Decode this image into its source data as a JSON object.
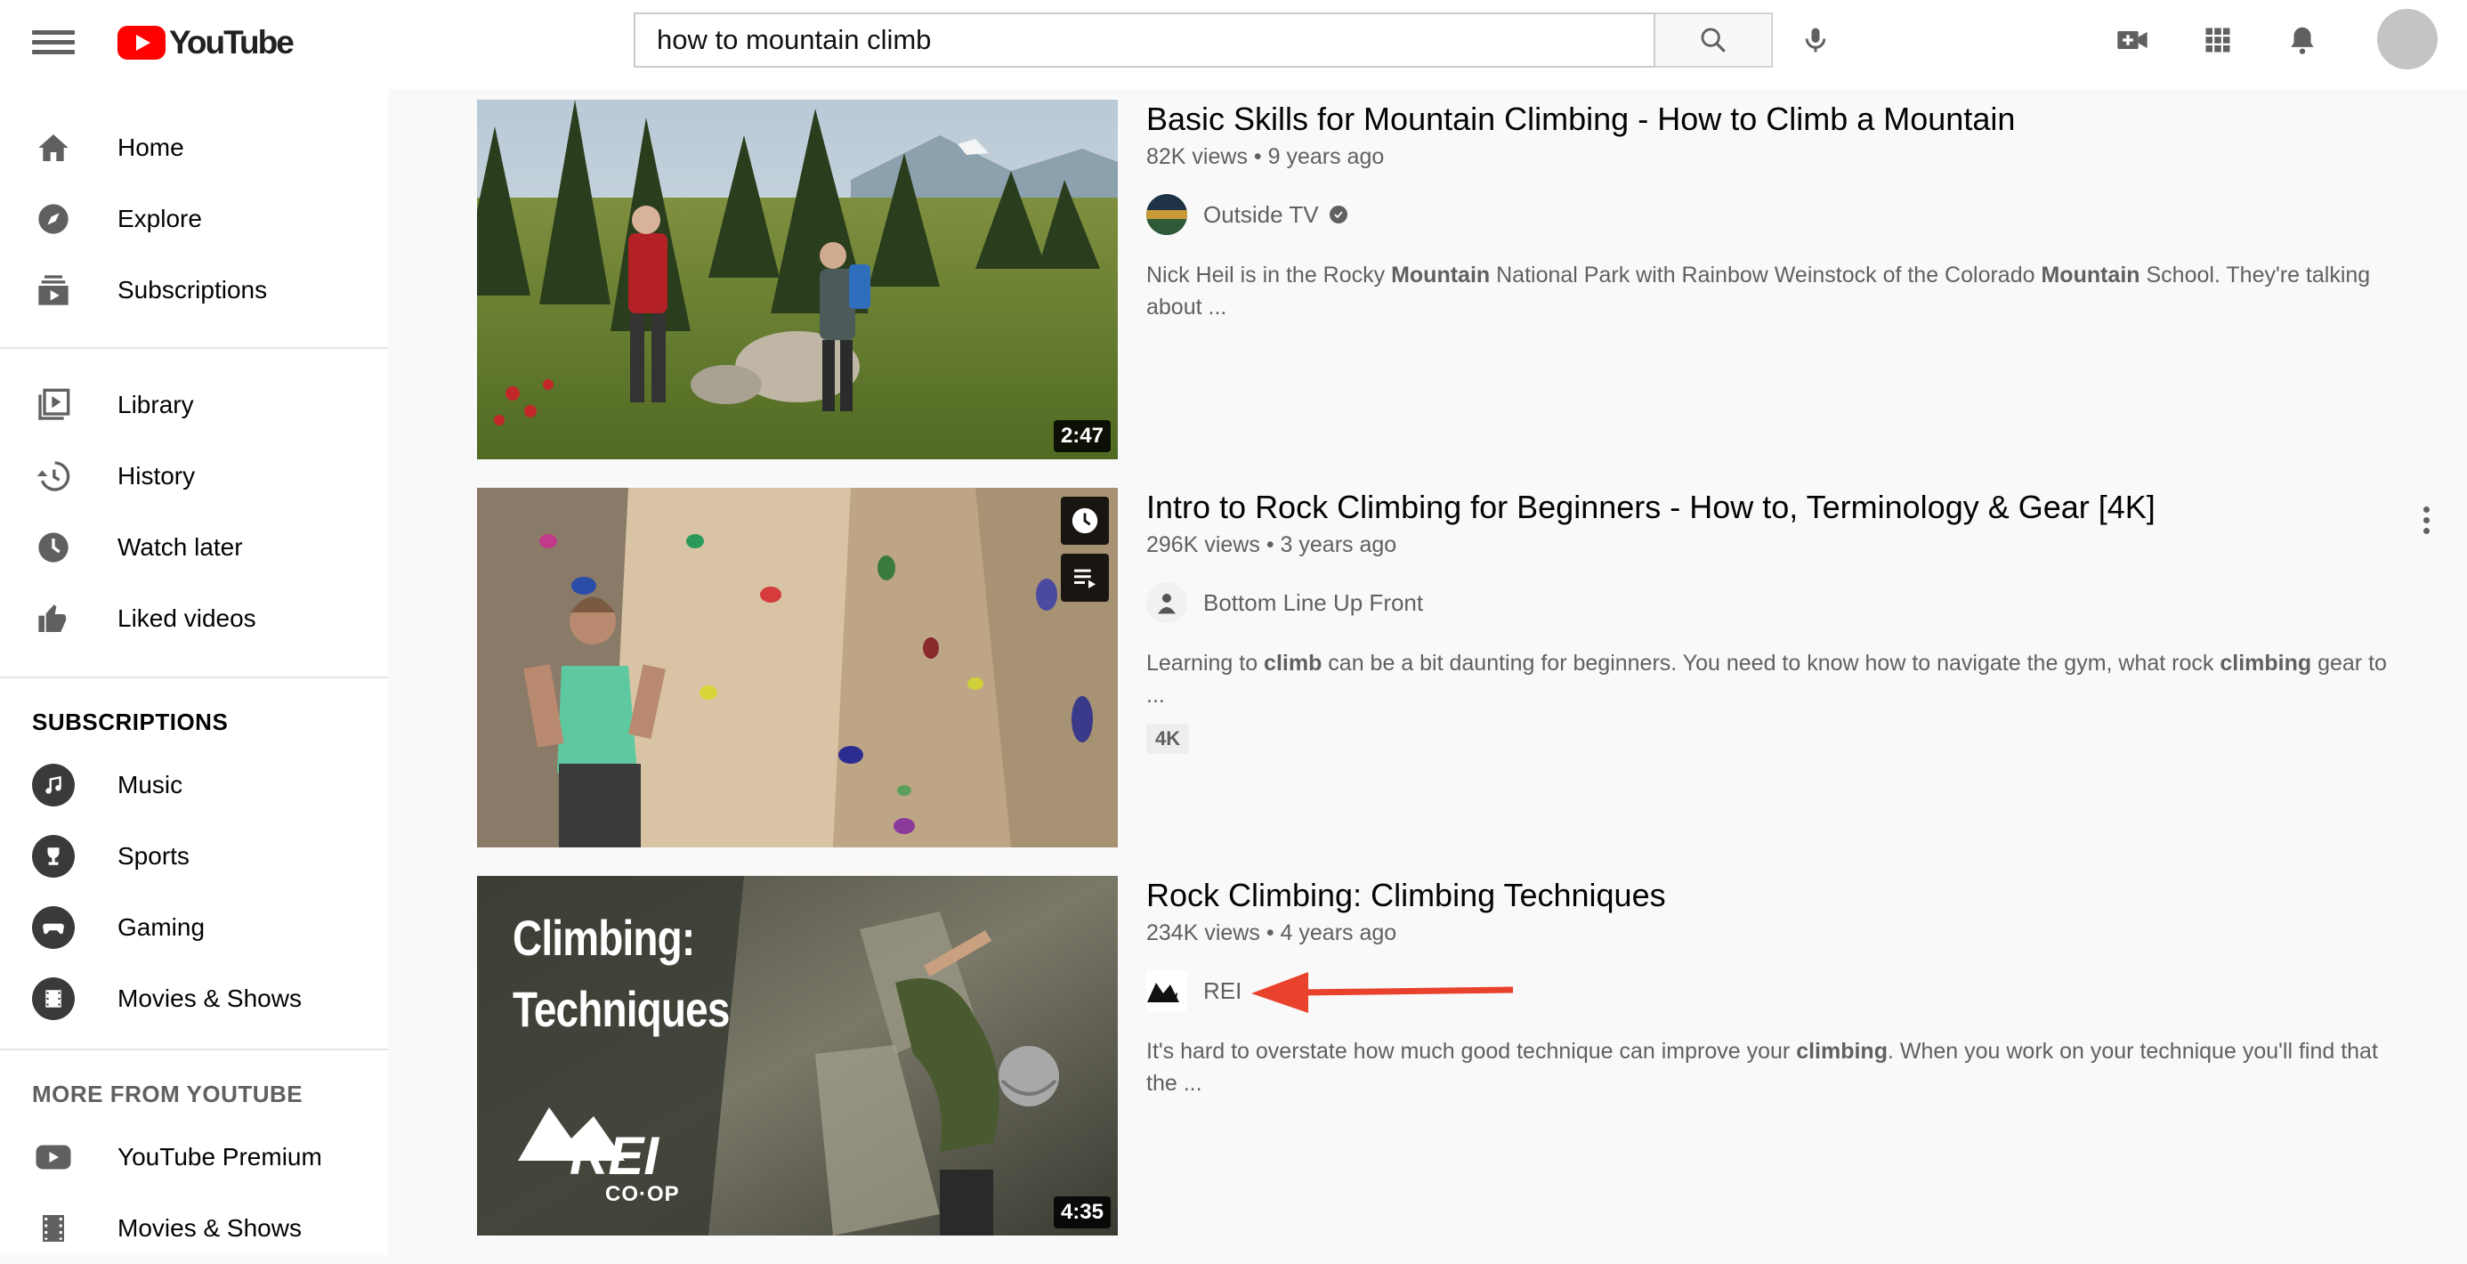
{
  "logo": {
    "text": "YouTube"
  },
  "search": {
    "query": "how to mountain climb"
  },
  "icons": {
    "menu": "menu-icon",
    "search": "search-icon",
    "mic": "microphone-icon",
    "create": "video-camera-icon",
    "apps": "apps-grid-icon",
    "notifications": "bell-icon"
  },
  "sidebar": {
    "main": [
      {
        "label": "Home",
        "icon": "home-icon"
      },
      {
        "label": "Explore",
        "icon": "compass-icon"
      },
      {
        "label": "Subscriptions",
        "icon": "subscriptions-icon"
      }
    ],
    "library": [
      {
        "label": "Library",
        "icon": "library-icon"
      },
      {
        "label": "History",
        "icon": "history-icon"
      },
      {
        "label": "Watch later",
        "icon": "clock-icon"
      },
      {
        "label": "Liked videos",
        "icon": "thumbs-up-icon"
      }
    ],
    "subscriptions_heading": "SUBSCRIPTIONS",
    "subscriptions": [
      {
        "label": "Music",
        "icon": "music-note-icon"
      },
      {
        "label": "Sports",
        "icon": "trophy-icon"
      },
      {
        "label": "Gaming",
        "icon": "gamepad-icon"
      },
      {
        "label": "Movies & Shows",
        "icon": "film-icon"
      }
    ],
    "more_heading": "MORE FROM YOUTUBE",
    "more": [
      {
        "label": "YouTube Premium",
        "icon": "youtube-icon"
      },
      {
        "label": "Movies & Shows",
        "icon": "film-strip-icon"
      }
    ]
  },
  "results": [
    {
      "title": "Basic Skills for Mountain Climbing - How to Climb a Mountain",
      "views": "82K views",
      "age": "9 years ago",
      "channel": "Outside TV",
      "verified": true,
      "duration": "2:47",
      "desc_parts": [
        "Nick Heil is in the Rocky ",
        "Mountain",
        " National Park with Rainbow Weinstock of the Colorado ",
        "Mountain",
        " School. They're talking about ..."
      ]
    },
    {
      "title": "Intro to Rock Climbing for Beginners - How to, Terminology & Gear [4K]",
      "views": "296K views",
      "age": "3 years ago",
      "channel": "Bottom Line Up Front",
      "badge": "4K",
      "desc_parts": [
        "Learning to ",
        "climb",
        " can be a bit daunting for beginners. You need to know how to navigate the gym, what rock ",
        "climbing",
        " gear to ..."
      ]
    },
    {
      "title": "Rock Climbing: Climbing Techniques",
      "views": "234K views",
      "age": "4 years ago",
      "channel": "REI",
      "duration": "4:35",
      "thumb_text_1": "Climbing:",
      "thumb_text_2": "Techniques",
      "thumb_logo": "REI",
      "thumb_logo_sub": "CO·OP",
      "desc_parts": [
        "It's hard to overstate how much good technique can improve your ",
        "climbing",
        ". When you work on your technique you'll find that the ..."
      ]
    }
  ],
  "meta_separator": "•",
  "colors": {
    "brand_red": "#ff0000",
    "annotation_arrow": "#e8412c"
  }
}
